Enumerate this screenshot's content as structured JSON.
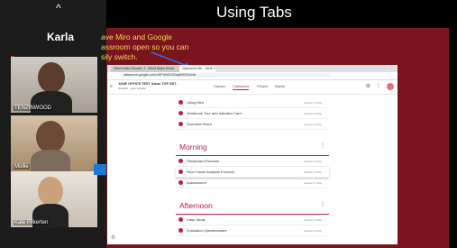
{
  "slide": {
    "title": "Using Tabs"
  },
  "sidebar": {
    "presenter": "Karla",
    "participants": [
      {
        "name": "TENZINWOOD"
      },
      {
        "name": "Mollie"
      },
      {
        "name": "Kate Pilkerten"
      }
    ]
  },
  "callout": {
    "text": "ave Miro and Google assroom open so you can sily switch."
  },
  "browser": {
    "tabs": [
      "Client Index Tutorial - Miro",
      "Client Steps Mural",
      "Classroom file - JANE OFFICE"
    ],
    "url": "classroom.google.com/c/MTIzNDU2Nzg5MDEy/t/all",
    "class_title": "JANE OFFICE TEST Salon TOP SET -",
    "class_sub": "2019/20 - Jane Smythe",
    "nav": [
      "Stream",
      "Classwork",
      "People",
      "Marks"
    ]
  },
  "classwork": {
    "top_items": [
      {
        "name": "Using Miro",
        "date": "Posted 27 May"
      },
      {
        "name": "Workbook Tour and Indicator Card",
        "date": "Posted 27 May"
      },
      {
        "name": "Overview Video",
        "date": "Posted 27 May"
      }
    ],
    "sections": [
      {
        "title": "Morning",
        "items": [
          {
            "name": "Storyboard Exercise",
            "date": "Posted 27 May"
          },
          {
            "name": "Root Cause Analysis Exercise",
            "date": "Posted 27 May"
          },
          {
            "name": "Assessment",
            "date": "Posted 27 May"
          }
        ]
      },
      {
        "title": "Afternoon",
        "items": [
          {
            "name": "Case Study",
            "date": "Posted 27 May"
          },
          {
            "name": "Evaluation Questionnaire",
            "date": "Posted 27 May"
          }
        ]
      }
    ]
  },
  "colors": {
    "slide_bg": "#7a1520",
    "accent": "#c2185b",
    "callout": "#f7d64a"
  }
}
